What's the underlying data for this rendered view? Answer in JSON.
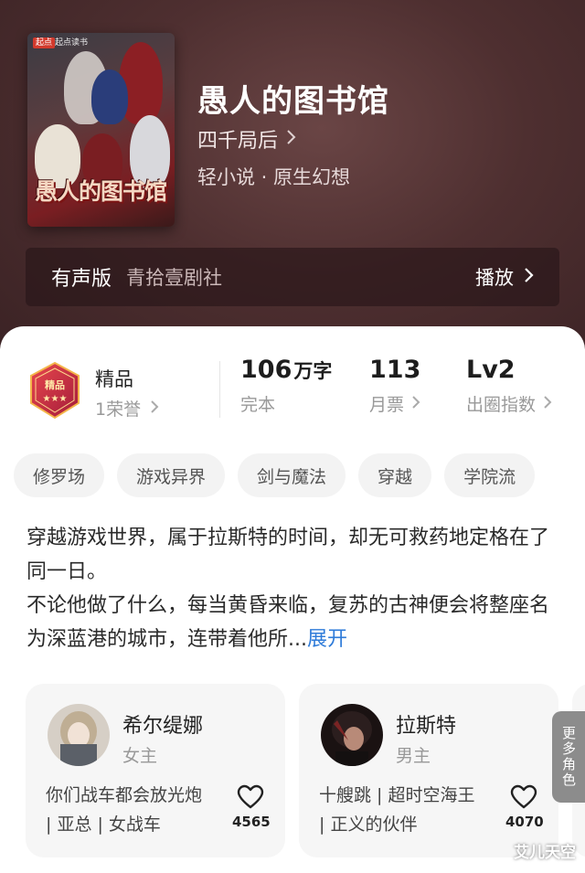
{
  "book": {
    "cover_badge": "起点",
    "cover_publisher": "起点读书",
    "cover_title": "愚人的图书馆",
    "title": "愚人的图书馆",
    "author": "四千局后",
    "genre": "轻小说 · 原生幻想"
  },
  "audio": {
    "label": "有声版",
    "studio": "青拾壹剧社",
    "play_label": "播放"
  },
  "stats": {
    "quality_title": "精品",
    "quality_sub": "1荣誉",
    "words_num": "106",
    "words_unit": "万字",
    "words_label": "完本",
    "tickets_num": "113",
    "tickets_label": "月票",
    "level_num": "Lv2",
    "level_label": "出圈指数"
  },
  "tags": [
    "修罗场",
    "游戏异界",
    "剑与魔法",
    "穿越",
    "学院流"
  ],
  "synopsis": {
    "line1": "穿越游戏世界，属于拉斯特的时间，却无可救药地定格在了同一日。",
    "line2": "不论他做了什么，每当黄昏来临，复苏的古神便会将整座名为深蓝港的城市，连带着他所...",
    "more_label": "展开"
  },
  "characters": [
    {
      "name": "希尔缇娜",
      "role": "女主",
      "desc": "你们战车都会放光炮 | 亚总 | 女战车",
      "likes": "4565"
    },
    {
      "name": "拉斯特",
      "role": "男主",
      "desc": "十艘跳 | 超时空海王 | 正义的伙伴",
      "likes": "4070"
    }
  ],
  "more_roles_label": "更多角色",
  "watermark": "艾儿天空",
  "colors": {
    "hero_bg": "#4e2f30",
    "link": "#2e7bd9",
    "tag_bg": "#f3f3f3",
    "card_bg": "#f6f6f6"
  }
}
